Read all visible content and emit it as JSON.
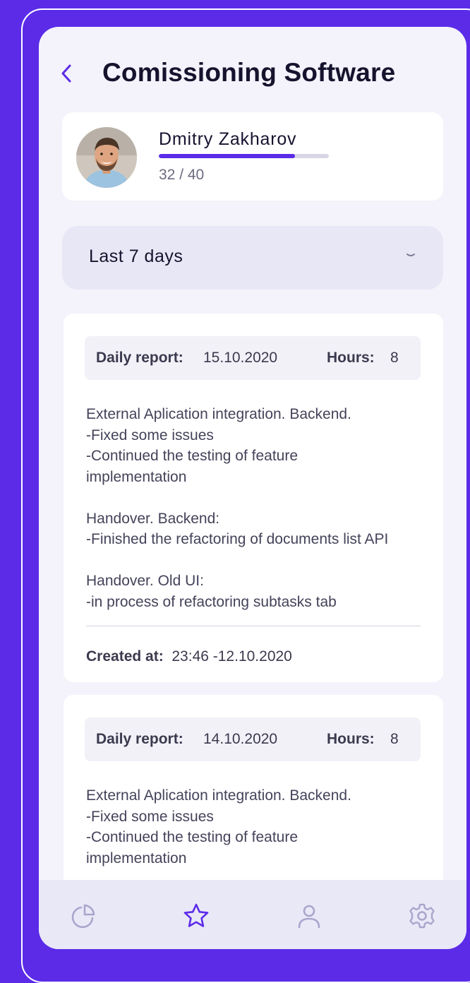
{
  "header": {
    "title": "Comissioning Software",
    "back_icon": "chevron-left-icon"
  },
  "profile": {
    "name": "Dmitry Zakharov",
    "progress_text": "32 / 40",
    "progress_value": 32,
    "progress_max": 40
  },
  "filter": {
    "selected": "Last 7 days",
    "icon": "chevron-down-icon"
  },
  "reports": [
    {
      "label": "Daily report:",
      "date": "15.10.2020",
      "hours_label": "Hours:",
      "hours": "8",
      "lines": [
        "External Aplication integration. Backend.",
        "-Fixed some issues",
        "-Continued the testing of feature",
        "implementation",
        "",
        "Handover. Backend:",
        "-Finished the refactoring of documents list API",
        "",
        "Handover. Old UI:",
        "-in process of refactoring subtasks tab"
      ],
      "created_label": "Created at:",
      "created_value": "23:46 -12.10.2020"
    },
    {
      "label": "Daily report:",
      "date": "14.10.2020",
      "hours_label": "Hours:",
      "hours": "8",
      "lines": [
        "External Aplication integration. Backend.",
        "-Fixed some issues",
        "-Continued the testing of feature",
        "implementation"
      ]
    }
  ],
  "tabbar": {
    "tabs": [
      {
        "icon": "pie-chart-icon",
        "active": false
      },
      {
        "icon": "star-icon",
        "active": true
      },
      {
        "icon": "user-icon",
        "active": false
      },
      {
        "icon": "settings-gear-icon",
        "active": false
      }
    ]
  },
  "colors": {
    "background": "#5b2be8",
    "accent": "#5b2be8",
    "inactive_icon": "#a9a6cc",
    "title": "#16132e"
  }
}
